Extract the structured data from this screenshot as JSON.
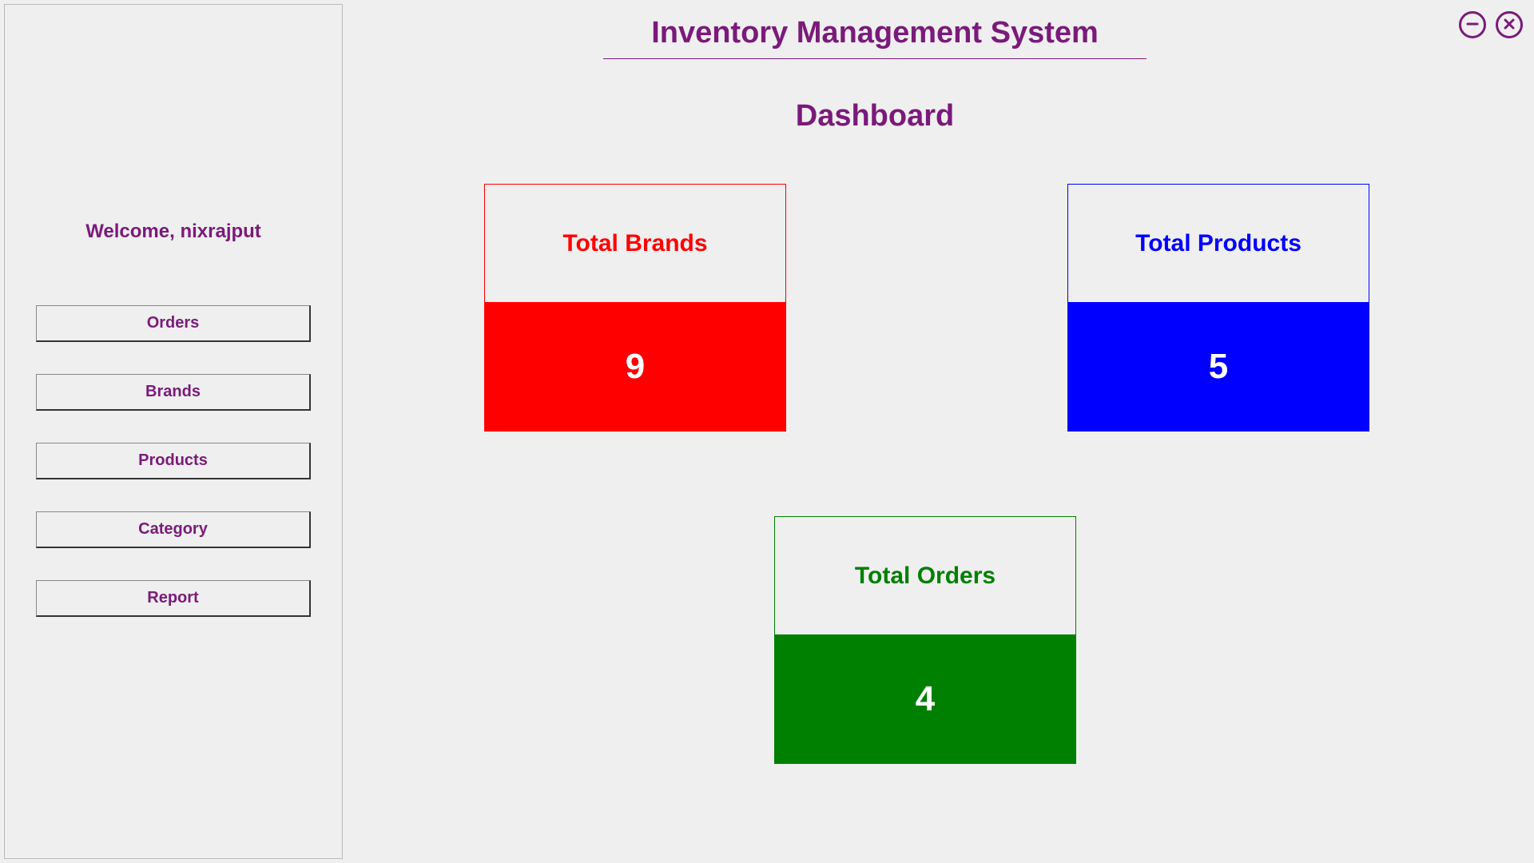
{
  "header": {
    "app_title": "Inventory Management System",
    "section_title": "Dashboard"
  },
  "sidebar": {
    "welcome": "Welcome, nixrajput",
    "items": [
      {
        "label": "Orders"
      },
      {
        "label": "Brands"
      },
      {
        "label": "Products"
      },
      {
        "label": "Category"
      },
      {
        "label": "Report"
      }
    ]
  },
  "cards": {
    "brands": {
      "label": "Total Brands",
      "value": "9"
    },
    "products": {
      "label": "Total Products",
      "value": "5"
    },
    "orders": {
      "label": "Total Orders",
      "value": "4"
    }
  },
  "colors": {
    "primary": "#7a1a7a",
    "brands": "#ff0000",
    "products": "#0000ff",
    "orders": "#008000"
  }
}
